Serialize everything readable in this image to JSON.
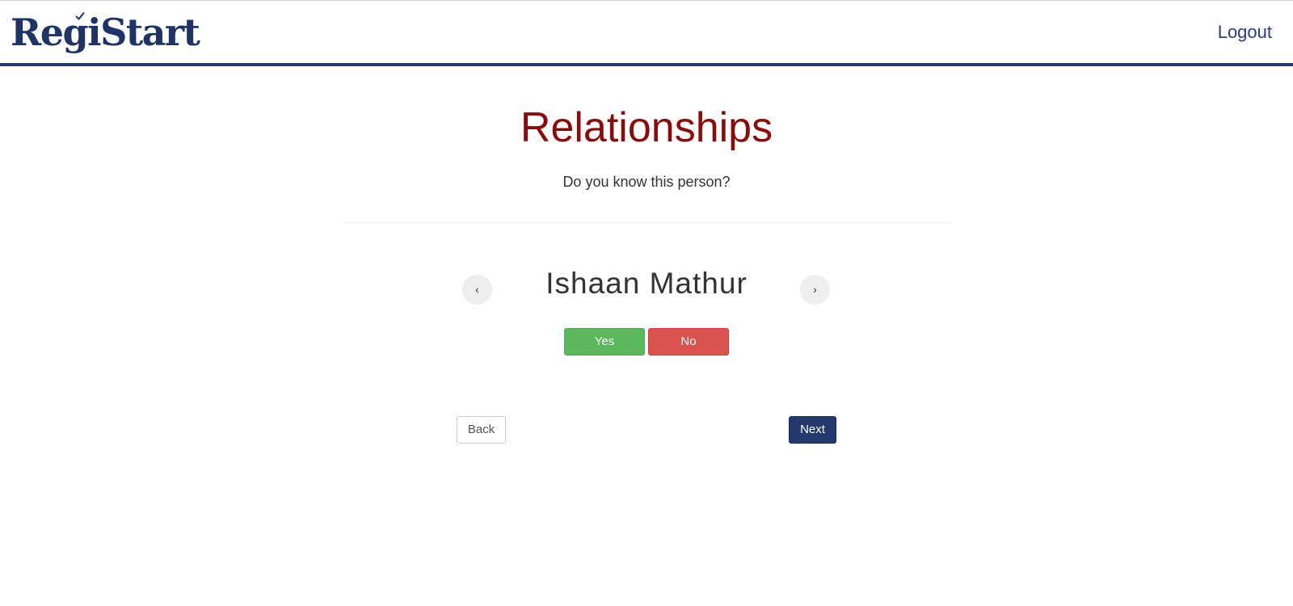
{
  "header": {
    "logo_text": "RegiStart",
    "logout_label": "Logout",
    "brand_color": "#23396e"
  },
  "main": {
    "title": "Relationships",
    "subtitle": "Do you know this person?",
    "person_name": "Ishaan Mathur",
    "prev_symbol": "‹",
    "next_symbol": "›",
    "yes_label": "Yes",
    "no_label": "No",
    "title_color": "#8b0a0a",
    "yes_color": "#5cb85c",
    "no_color": "#d9534f"
  },
  "footer_nav": {
    "back_label": "Back",
    "next_label": "Next"
  }
}
